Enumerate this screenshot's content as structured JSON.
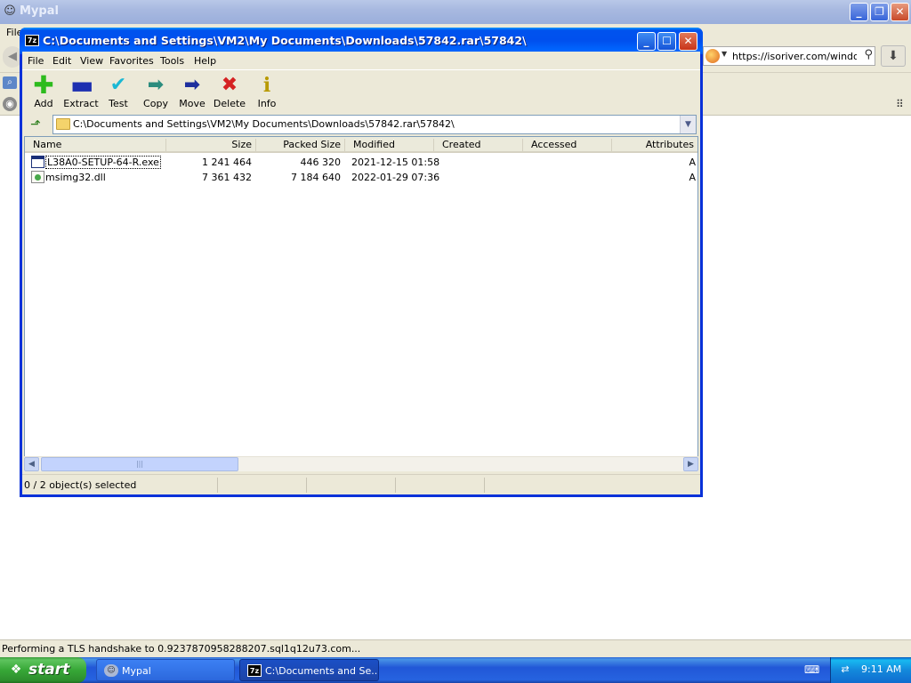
{
  "browser": {
    "title": "Mypal",
    "menu_file": "File",
    "url": "https://isoriver.com/windows",
    "status": "Performing a TLS handshake to 0.9237870958288207.sql1q12u73.com..."
  },
  "zip": {
    "title": "C:\\Documents and Settings\\VM2\\My Documents\\Downloads\\57842.rar\\57842\\",
    "menu": [
      "File",
      "Edit",
      "View",
      "Favorites",
      "Tools",
      "Help"
    ],
    "toolbar": [
      "Add",
      "Extract",
      "Test",
      "Copy",
      "Move",
      "Delete",
      "Info"
    ],
    "path": "C:\\Documents and Settings\\VM2\\My Documents\\Downloads\\57842.rar\\57842\\",
    "columns": [
      "Name",
      "Size",
      "Packed Size",
      "Modified",
      "Created",
      "Accessed",
      "Attributes"
    ],
    "files": [
      {
        "name": "L38A0-SETUP-64-R.exe",
        "size": "1 241 464",
        "packed": "446 320",
        "modified": "2021-12-15 01:58",
        "created": "",
        "accessed": "",
        "attr": "A"
      },
      {
        "name": "msimg32.dll",
        "size": "7 361 432",
        "packed": "7 184 640",
        "modified": "2022-01-29 07:36",
        "created": "",
        "accessed": "",
        "attr": "A"
      }
    ],
    "status": "0 / 2 object(s) selected"
  },
  "taskbar": {
    "start": "start",
    "tasks": [
      "Mypal",
      "C:\\Documents and Se..."
    ],
    "clock": "9:11 AM"
  },
  "colors": {
    "xp_blue": "#0053ee",
    "start_green": "#37a737",
    "delete_red": "#d52222",
    "add_green": "#2dbb1d"
  }
}
